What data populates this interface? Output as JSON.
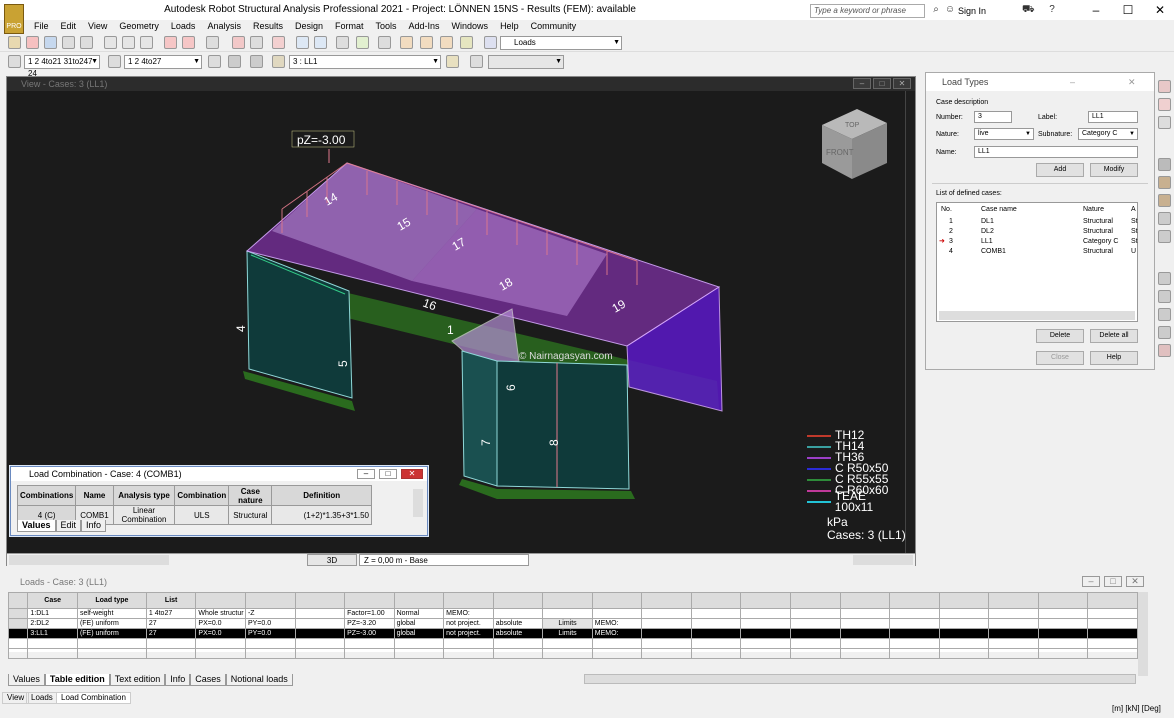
{
  "app": {
    "title": "Autodesk Robot Structural Analysis Professional 2021 - Project: LÖNNEN 15NS - Results (FEM): available",
    "search_placeholder": "Type a keyword or phrase",
    "sign_in": "Sign In",
    "logo": "PRO"
  },
  "menu": [
    "File",
    "Edit",
    "View",
    "Geometry",
    "Loads",
    "Analysis",
    "Results",
    "Design",
    "Format",
    "Tools",
    "Add-Ins",
    "Windows",
    "Help",
    "Community"
  ],
  "toolbar": {
    "layout_combo": "Loads",
    "selection_combo": "1 2 4to21 31to247 24",
    "bars_combo": "1 2 4to27",
    "case_combo": "3 : LL1"
  },
  "view": {
    "title": "View - Cases: 3 (LL1)",
    "load_label": "pZ=-3.00",
    "watermark": "© Nairnagasyan.com",
    "mode_3d": "3D",
    "level": "Z = 0,00 m - Base",
    "legend": [
      {
        "name": "TH12",
        "color": "#c0392b"
      },
      {
        "name": "TH14",
        "color": "#3aa0a0"
      },
      {
        "name": "TH36",
        "color": "#9b3fc6"
      },
      {
        "name": "C R50x50",
        "color": "#2b2bd6"
      },
      {
        "name": "C R55x55",
        "color": "#2e8b3a"
      },
      {
        "name": "C R60x60",
        "color": "#c0399a"
      },
      {
        "name": "TEAE 100x11",
        "color": "#22c3d6"
      }
    ],
    "units": "kPa",
    "cases": "Cases: 3 (LL1)",
    "viewcube": {
      "top": "TOP",
      "front": "FRONT",
      "right": "RIGHT"
    },
    "numbers": [
      "14",
      "15",
      "17",
      "16",
      "18",
      "19",
      "4",
      "5",
      "1",
      "6",
      "7",
      "8"
    ]
  },
  "load_combination": {
    "title": "Load Combination - Case: 4 (COMB1)",
    "headers": [
      "Combinations",
      "Name",
      "Analysis type",
      "Combination",
      "Case nature",
      "Definition"
    ],
    "row": [
      "4 (C)",
      "COMB1",
      "Linear Combination",
      "ULS",
      "Structural",
      "(1+2)*1.35+3*1.50"
    ],
    "tabs": [
      "Values",
      "Edit",
      "Info"
    ]
  },
  "load_types": {
    "title": "Load Types",
    "section": "Case description",
    "number_label": "Number:",
    "number": "3",
    "label_label": "Label:",
    "label": "LL1",
    "nature_label": "Nature:",
    "nature": "live",
    "subnature_label": "Subnature:",
    "subnature": "Category C",
    "name_label": "Name:",
    "name": "LL1",
    "add": "Add",
    "modify": "Modify",
    "list_label": "List of defined cases:",
    "list_headers": [
      "No.",
      "Case name",
      "Nature",
      "A"
    ],
    "cases": [
      {
        "no": "1",
        "name": "DL1",
        "nature": "Structural",
        "a": "St"
      },
      {
        "no": "2",
        "name": "DL2",
        "nature": "Structural",
        "a": "St"
      },
      {
        "no": "3",
        "name": "LL1",
        "nature": "Category C",
        "a": "St"
      },
      {
        "no": "4",
        "name": "COMB1",
        "nature": "Structural",
        "a": "U"
      }
    ],
    "delete": "Delete",
    "delete_all": "Delete all",
    "close": "Close",
    "help": "Help"
  },
  "loads": {
    "title": "Loads - Case: 3 (LL1)",
    "headers": [
      "Case",
      "Load type",
      "List",
      "",
      "",
      "",
      "",
      "",
      "",
      "",
      "",
      "",
      ""
    ],
    "rows": [
      [
        "1:DL1",
        "self-weight",
        "1 4to27",
        "Whole structur",
        "-Z",
        "",
        "Factor=1.00",
        "Normal",
        "MEMO:",
        "",
        "",
        ""
      ],
      [
        "2:DL2",
        "(FE) uniform",
        "27",
        "PX=0.0",
        "PY=0.0",
        "",
        "PZ=-3.20",
        "global",
        "not project.",
        "absolute",
        "Limits",
        "MEMO:"
      ],
      [
        "3:LL1",
        "(FE) uniform",
        "27",
        "PX=0.0",
        "PY=0.0",
        "",
        "PZ=-3.00",
        "global",
        "not project.",
        "absolute",
        "Limits",
        "MEMO:"
      ]
    ],
    "tabs": [
      "Values",
      "Table edition",
      "Text edition",
      "Info",
      "Cases",
      "Notional loads"
    ]
  },
  "status": {
    "tabs": [
      "View",
      "Loads",
      "Load Combination"
    ],
    "units": "[m] [kN] [Deg]"
  }
}
